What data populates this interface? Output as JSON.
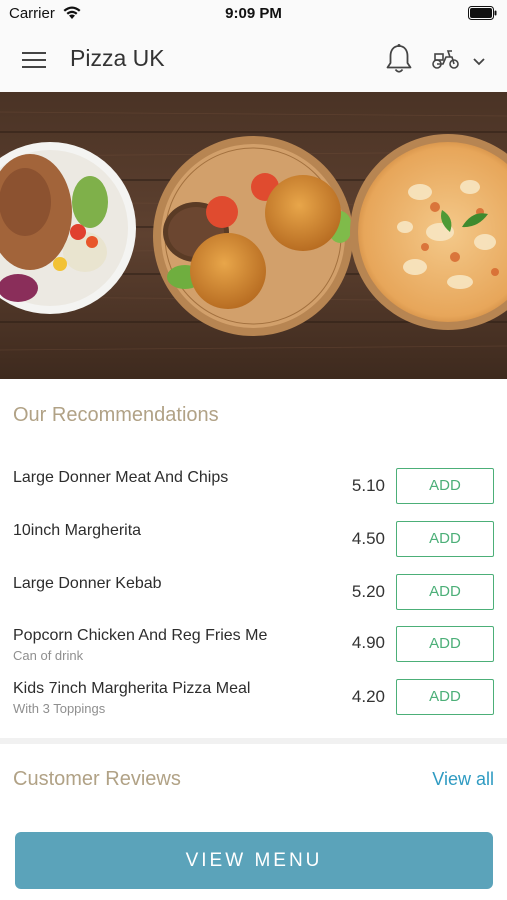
{
  "status_bar": {
    "carrier": "Carrier",
    "time": "9:09 PM"
  },
  "header": {
    "title": "Pizza UK"
  },
  "recommendations": {
    "title": "Our Recommendations",
    "items": [
      {
        "name": "Large Donner Meat And Chips",
        "subtitle": "",
        "price": "5.10",
        "button": "ADD"
      },
      {
        "name": "10inch Margherita",
        "subtitle": "",
        "price": "4.50",
        "button": "ADD"
      },
      {
        "name": "Large Donner Kebab",
        "subtitle": "",
        "price": "5.20",
        "button": "ADD"
      },
      {
        "name": "Popcorn Chicken And Reg Fries Me",
        "subtitle": "Can of drink",
        "price": "4.90",
        "button": "ADD"
      },
      {
        "name": "Kids 7inch Margherita Pizza Meal",
        "subtitle": "With 3 Toppings",
        "price": "4.20",
        "button": "ADD"
      }
    ]
  },
  "reviews": {
    "title": "Customer Reviews",
    "view_all": "View all"
  },
  "footer": {
    "view_menu": "VIEW MENU"
  },
  "colors": {
    "accent_gold": "#b1a286",
    "add_green": "#4caf78",
    "link_blue": "#2f9bc2",
    "menu_button": "#5ba3ba"
  },
  "icons": [
    "wifi-icon",
    "battery-icon",
    "menu-icon",
    "bell-icon",
    "scooter-icon",
    "chevron-down-icon"
  ]
}
